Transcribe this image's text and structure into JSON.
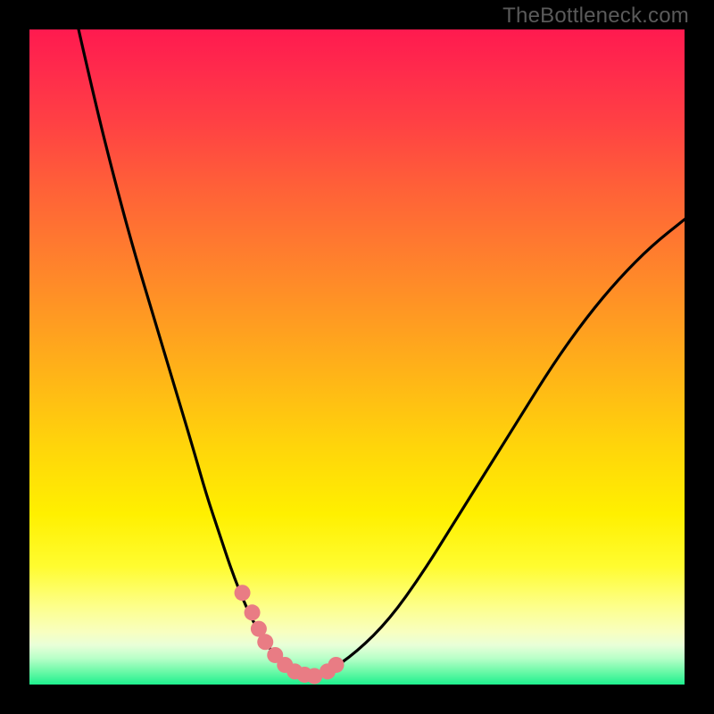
{
  "watermark": "TheBottleneck.com",
  "chart_data": {
    "type": "line",
    "title": "",
    "xlabel": "",
    "ylabel": "",
    "xlim": [
      0,
      100
    ],
    "ylim": [
      0,
      100
    ],
    "gradient_colors": {
      "top": "#ff1a4f",
      "mid_orange": "#ff9a22",
      "mid_yellow": "#ffd60a",
      "bottom": "#1ef08e"
    },
    "series": [
      {
        "name": "bottleneck-curve",
        "type": "line",
        "color": "#000000",
        "x": [
          7.5,
          10,
          13,
          16,
          19,
          22,
          25,
          27,
          29,
          31,
          33,
          35,
          37,
          39,
          41,
          43,
          45,
          50,
          55,
          60,
          65,
          70,
          75,
          80,
          85,
          90,
          95,
          100
        ],
        "y": [
          100,
          89,
          77,
          66,
          56,
          46,
          36,
          29,
          23,
          17,
          12,
          8,
          5,
          3,
          1.5,
          1,
          1.5,
          5,
          10,
          17,
          25,
          33,
          41,
          49,
          56,
          62,
          67,
          71
        ]
      },
      {
        "name": "highlight-dots",
        "type": "scatter",
        "color": "#e97c84",
        "marker_size": 18,
        "x": [
          32.5,
          34.0,
          35.0,
          36.0,
          37.5,
          39.0,
          40.5,
          42.0,
          43.5,
          45.5,
          46.8
        ],
        "y": [
          14.0,
          11.0,
          8.5,
          6.5,
          4.5,
          3.0,
          2.0,
          1.5,
          1.3,
          2.0,
          3.0
        ]
      }
    ]
  }
}
